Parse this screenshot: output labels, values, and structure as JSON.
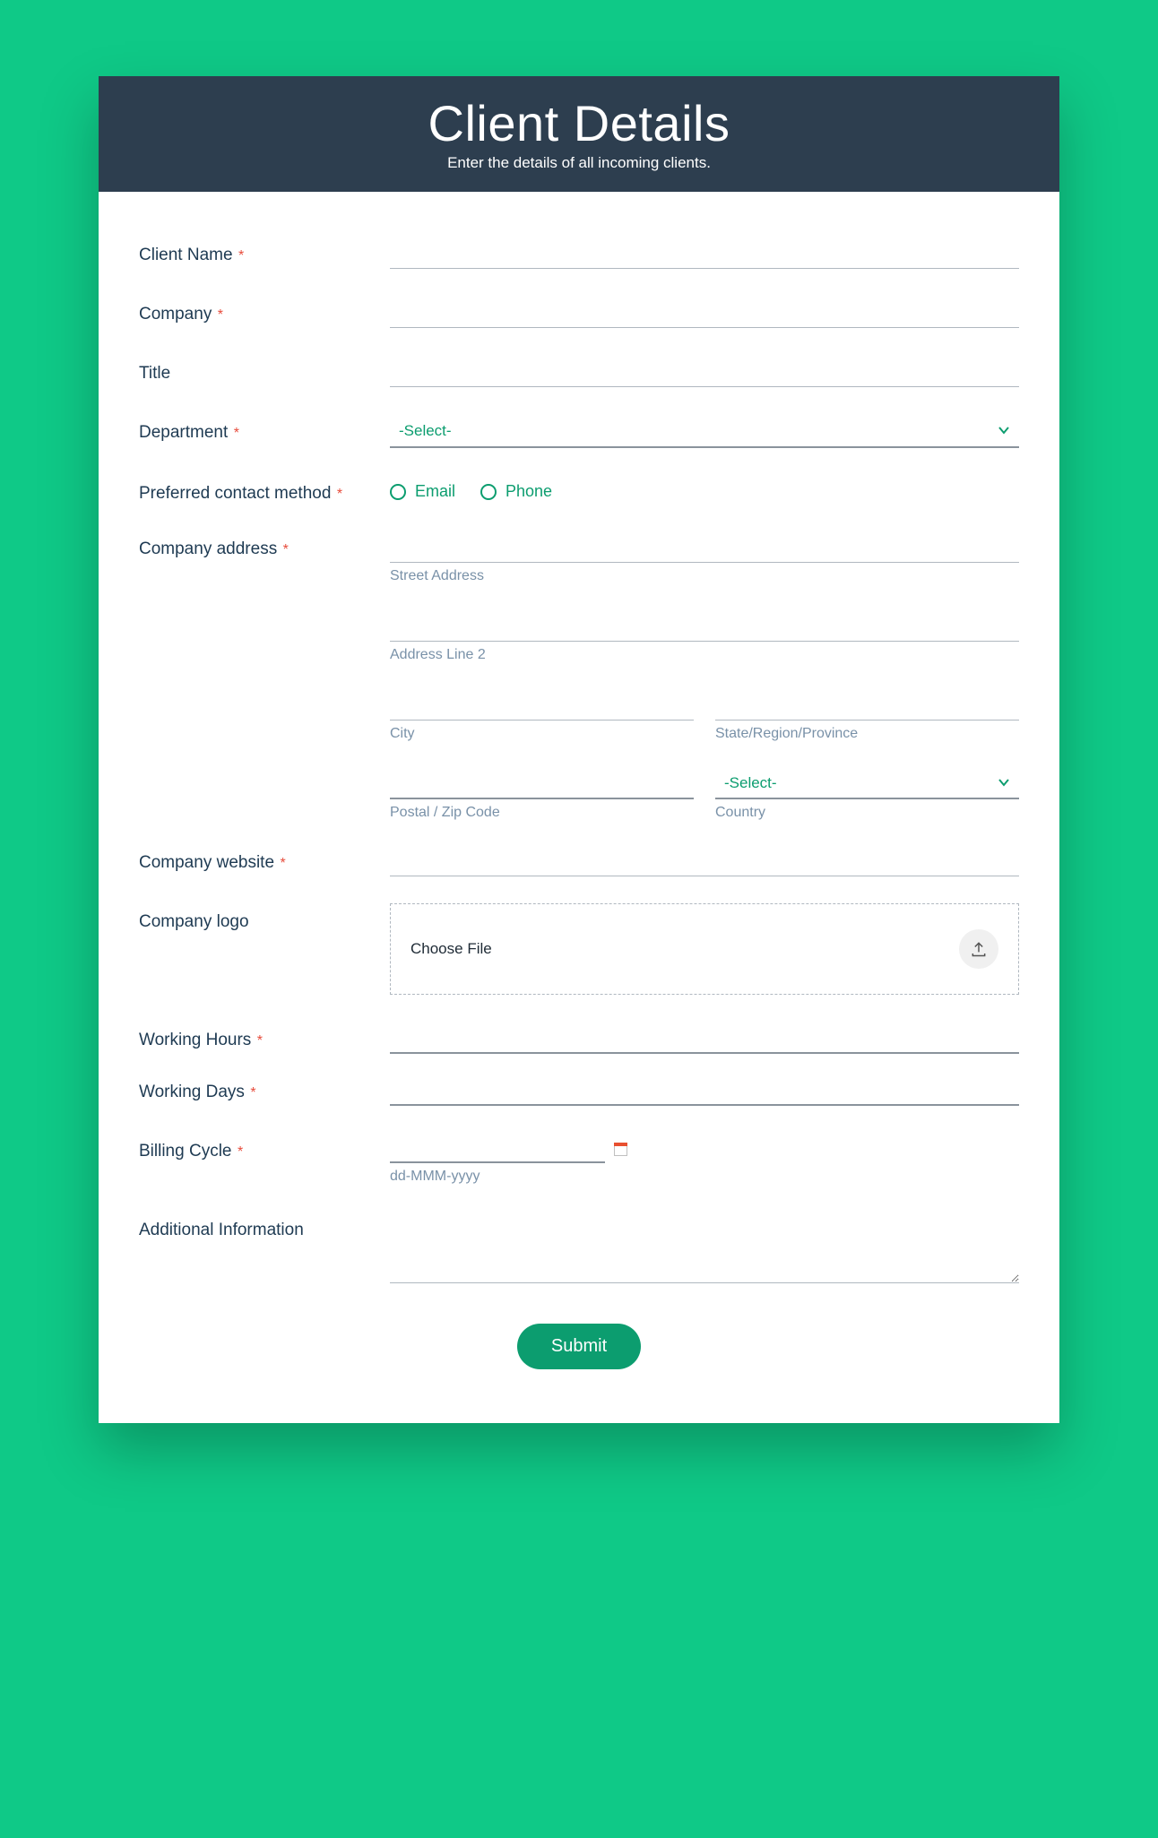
{
  "header": {
    "title": "Client Details",
    "subtitle": "Enter the details of all incoming clients."
  },
  "labels": {
    "client_name": "Client Name",
    "company": "Company",
    "title": "Title",
    "department": "Department",
    "contact_method": "Preferred contact method",
    "company_address": "Company address",
    "company_website": "Company website",
    "company_logo": "Company logo",
    "working_hours": "Working Hours",
    "working_days": "Working Days",
    "billing_cycle": "Billing Cycle",
    "additional_info": "Additional Information"
  },
  "required_marker": "*",
  "select_placeholder": "-Select-",
  "contact_options": {
    "email": "Email",
    "phone": "Phone"
  },
  "address_sublabels": {
    "street": "Street Address",
    "line2": "Address Line 2",
    "city": "City",
    "state": "State/Region/Province",
    "postal": "Postal / Zip Code",
    "country": "Country"
  },
  "upload": {
    "choose_file": "Choose File"
  },
  "date_format": "dd-MMM-yyyy",
  "submit": "Submit"
}
